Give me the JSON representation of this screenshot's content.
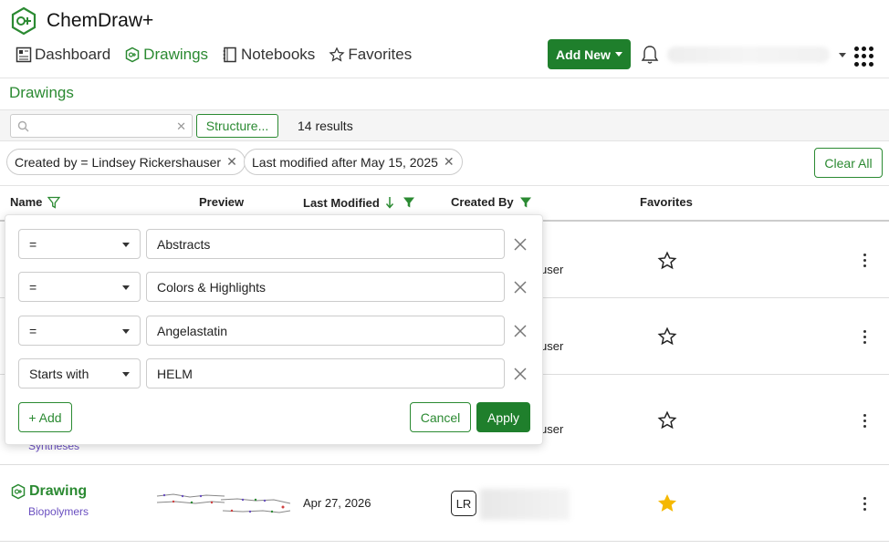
{
  "app": {
    "name": "ChemDraw+"
  },
  "nav": [
    {
      "label": "Dashboard",
      "icon": "dashboard-icon",
      "active": false
    },
    {
      "label": "Drawings",
      "icon": "drawing-icon",
      "active": true
    },
    {
      "label": "Notebooks",
      "icon": "notebook-icon",
      "active": false
    },
    {
      "label": "Favorites",
      "icon": "star-icon",
      "active": false
    }
  ],
  "header": {
    "add_new_label": "Add New"
  },
  "page": {
    "title": "Drawings"
  },
  "search": {
    "value": "",
    "placeholder": "",
    "structure_label": "Structure...",
    "results": "14 results"
  },
  "filters": {
    "chips": [
      "Created by = Lindsey Rickershauser",
      "Last modified after May 15, 2025"
    ],
    "clear_all_label": "Clear All"
  },
  "table": {
    "columns": [
      "Name",
      "Preview",
      "Last Modified",
      "Created By",
      "Favorites"
    ],
    "rows": [
      {
        "created_by_partial": "user",
        "favorite": false
      },
      {
        "created_by_partial": "user",
        "favorite": false
      },
      {
        "category": "Syntheses",
        "created_by_partial": "user",
        "favorite": false
      },
      {
        "name": "Drawing",
        "category": "Biopolymers",
        "last_modified": "Apr 27, 2026",
        "created_by_initials": "LR",
        "favorite": true
      }
    ]
  },
  "name_filter_popover": {
    "conditions": [
      {
        "operator": "=",
        "value": "Abstracts"
      },
      {
        "operator": "=",
        "value": "Colors & Highlights"
      },
      {
        "operator": "=",
        "value": "Angelastatin"
      },
      {
        "operator": "Starts with",
        "value": "HELM"
      }
    ],
    "add_label": "+ Add",
    "cancel_label": "Cancel",
    "apply_label": "Apply"
  },
  "colors": {
    "brand": "#2b8a32",
    "primary_button": "#1f7f2c",
    "category": "#6a4fc0",
    "favorite": "#f5b800"
  }
}
